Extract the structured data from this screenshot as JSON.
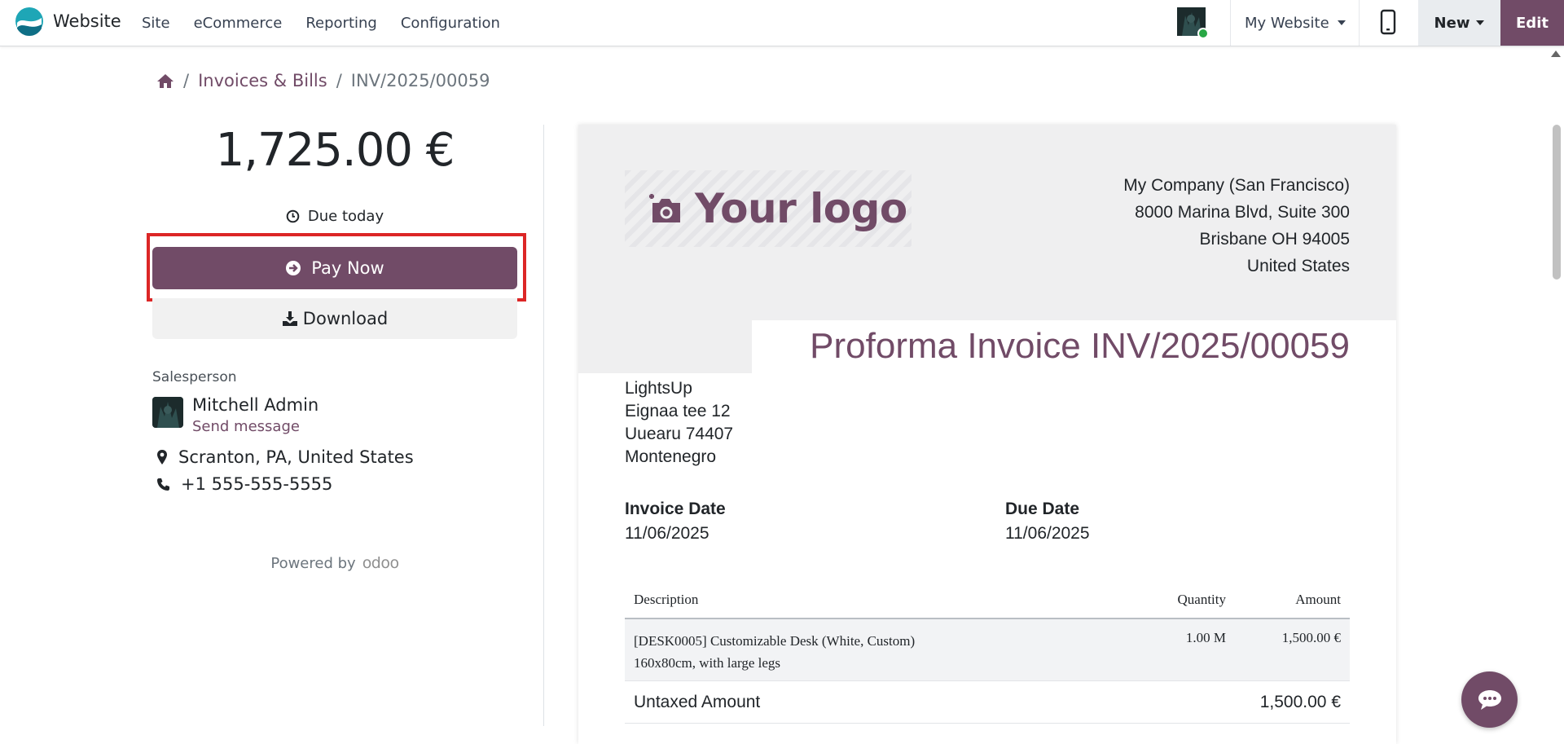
{
  "topbar": {
    "app_name": "Website",
    "menu": [
      "Site",
      "eCommerce",
      "Reporting",
      "Configuration"
    ],
    "website_switch": "My Website",
    "new_label": "New",
    "edit_label": "Edit"
  },
  "breadcrumb": {
    "items": [
      "Invoices & Bills"
    ],
    "current": "INV/2025/00059"
  },
  "summary": {
    "amount": "1,725.00 €",
    "due_text": "Due today",
    "pay_label": "Pay Now",
    "download_label": "Download"
  },
  "salesperson": {
    "label": "Salesperson",
    "name": "Mitchell Admin",
    "send_message": "Send message",
    "location": "Scranton, PA, United States",
    "phone": "+1 555-555-5555"
  },
  "footer": {
    "powered_by": "Powered by",
    "brand": "odoo"
  },
  "invoice": {
    "logo_text": "Your logo",
    "company": {
      "name": "My Company (San Francisco)",
      "street": "8000 Marina Blvd, Suite 300",
      "city": "Brisbane OH 94005",
      "country": "United States"
    },
    "title": "Proforma Invoice INV/2025/00059",
    "customer": {
      "name": "LightsUp",
      "street": "Eignaa tee 12",
      "city": "Uuearu 74407",
      "country": "Montenegro"
    },
    "invoice_date_label": "Invoice Date",
    "invoice_date": "11/06/2025",
    "due_date_label": "Due Date",
    "due_date": "11/06/2025",
    "columns": {
      "description": "Description",
      "quantity": "Quantity",
      "amount": "Amount"
    },
    "lines": [
      {
        "description": "[DESK0005] Customizable Desk (White, Custom)",
        "description_2": "160x80cm, with large legs",
        "quantity": "1.00 M",
        "amount": "1,500.00 €"
      }
    ],
    "untaxed_label": "Untaxed Amount",
    "untaxed_value": "1,500.00 €"
  },
  "colors": {
    "brand": "#714b67",
    "highlight": "#dc2626",
    "status_online": "#28a745"
  }
}
